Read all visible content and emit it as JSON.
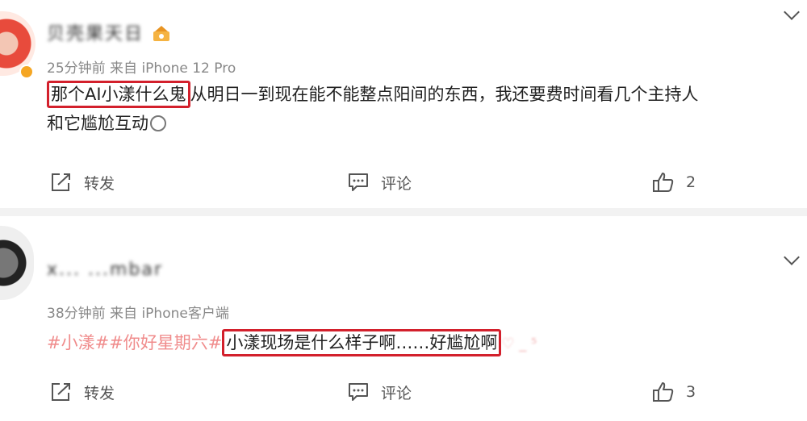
{
  "posts": [
    {
      "username": "贝壳果天日",
      "meta": "25分钟前 来自 iPhone 12 Pro",
      "highlight": "那个AI小漾什么鬼",
      "text_rest": "从明日一到现在能不能整点阳间的东西，我还要费时间看几个主持人",
      "text_line2": "和它尴尬互动",
      "actions": {
        "repost": "转发",
        "comment": "评论",
        "like_count": "2"
      }
    },
    {
      "username": "x...   ...mbar",
      "meta": "38分钟前 来自 iPhone客户端",
      "hashtags": "#小漾##你好星期六#",
      "highlight": "小漾现场是什么样子啊……好尴尬啊",
      "trailing": "♡ _ ⁵",
      "actions": {
        "repost": "转发",
        "comment": "评论",
        "like_count": "3"
      }
    }
  ],
  "icons": {
    "repost": "repost-icon",
    "comment": "comment-icon",
    "like": "thumbs-up-icon",
    "more": "chevron-down-icon",
    "vip": "vip-badge-icon"
  },
  "colors": {
    "highlight_box": "#d3202c",
    "hashtag": "#f08c8c",
    "meta": "#888888",
    "divider": "#f2f2f2"
  }
}
